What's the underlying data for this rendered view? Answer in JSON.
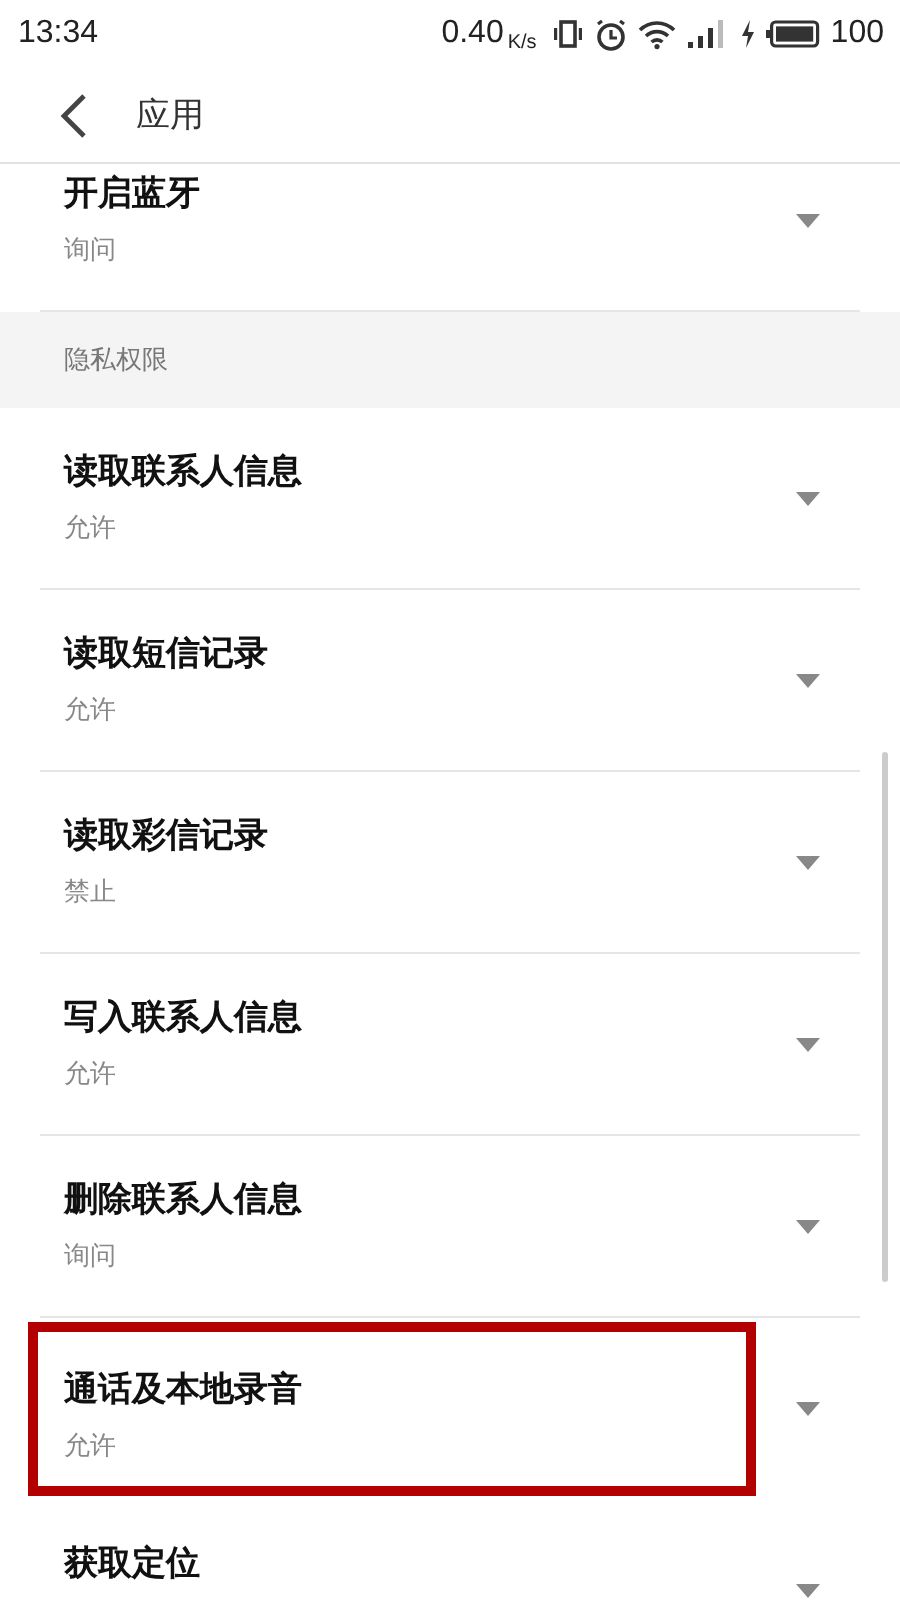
{
  "status_bar": {
    "time": "13:34",
    "speed": "0.40",
    "speed_unit": "K/s",
    "battery": "100"
  },
  "header": {
    "title": "应用"
  },
  "sections": [
    {
      "items": [
        {
          "title": "开启蓝牙",
          "value": "询问",
          "highlighted": false
        }
      ]
    },
    {
      "heading": "隐私权限",
      "items": [
        {
          "title": "读取联系人信息",
          "value": "允许",
          "highlighted": false
        },
        {
          "title": "读取短信记录",
          "value": "允许",
          "highlighted": false
        },
        {
          "title": "读取彩信记录",
          "value": "禁止",
          "highlighted": false
        },
        {
          "title": "写入联系人信息",
          "value": "允许",
          "highlighted": false
        },
        {
          "title": "删除联系人信息",
          "value": "询问",
          "highlighted": false
        },
        {
          "title": "通话及本地录音",
          "value": "允许",
          "highlighted": true
        },
        {
          "title": "获取定位",
          "highlighted": false
        }
      ]
    }
  ]
}
